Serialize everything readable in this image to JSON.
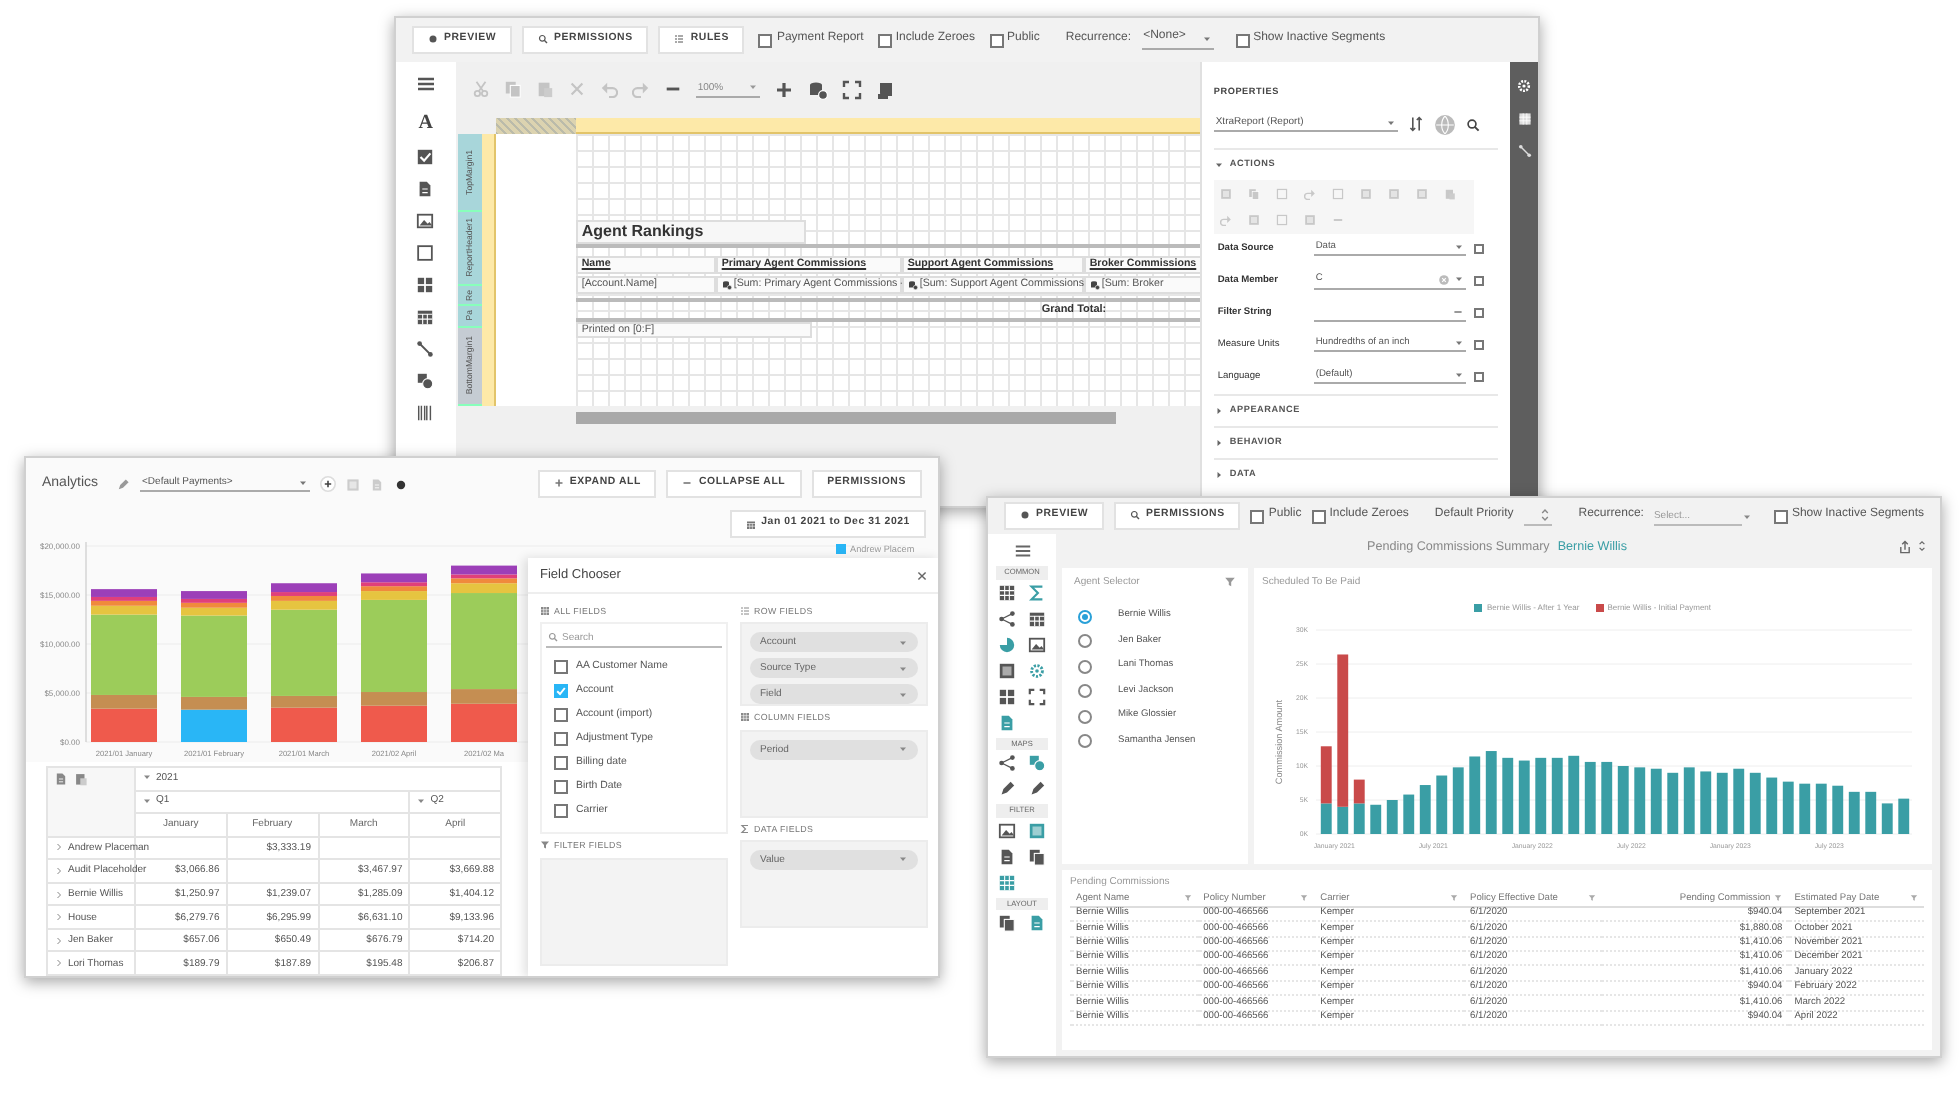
{
  "designer": {
    "buttons": [
      "PREVIEW",
      "PERMISSIONS",
      "RULES"
    ],
    "options": [
      {
        "label": "Payment Report",
        "checked": false
      },
      {
        "label": "Include Zeroes",
        "checked": false
      },
      {
        "label": "Public",
        "checked": false
      }
    ],
    "recurrence": {
      "label": "Recurrence:",
      "value": "<None>"
    },
    "show_inactive": {
      "label": "Show Inactive Segments",
      "checked": false
    },
    "toolbox_letter": "A",
    "zoom": "100%",
    "bands": [
      "TopMargin1",
      "ReportHeader1",
      "Re",
      "Pa",
      "BottomMargin1"
    ],
    "report": {
      "title": "Agent Rankings",
      "columns": [
        "Name",
        "Primary Agent Commissions",
        "Support Agent Commissions",
        "Broker Commissions"
      ],
      "fields": [
        "[Account.Name]",
        "[Sum: Primary Agent Commissions -",
        "[Sum: Support Agent Commissions",
        "[Sum: Broker"
      ],
      "total_label": "Grand Total:",
      "footer": "Printed on [0:F]"
    },
    "properties": {
      "heading": "PROPERTIES",
      "object": "XtraReport (Report)",
      "open_section": "ACTIONS",
      "rows": [
        {
          "label": "Data Source",
          "value": "Data",
          "kind": "select",
          "bold": true,
          "checked": false
        },
        {
          "label": "Data Member",
          "value": "C",
          "kind": "clearable",
          "bold": true,
          "checked": false
        },
        {
          "label": "Filter String",
          "kind": "editor",
          "bold": true,
          "checked": false
        },
        {
          "label": "Measure Units",
          "value": "Hundredths of an inch",
          "kind": "select",
          "bold": false,
          "checked": false
        },
        {
          "label": "Language",
          "value": "(Default)",
          "kind": "select",
          "bold": false,
          "checked": false
        }
      ],
      "sections": [
        "APPEARANCE",
        "BEHAVIOR",
        "DATA"
      ]
    }
  },
  "analytics": {
    "title": "Analytics",
    "layout": "<Default Payments>",
    "buttons": [
      "EXPAND ALL",
      "COLLAPSE ALL",
      "PERMISSIONS"
    ],
    "date_range": "Jan 01 2021 to Dec 31 2021",
    "chart_data": {
      "type": "bar",
      "stacked": true,
      "grid": true,
      "ylim": [
        0,
        20000
      ],
      "categories": [
        "2021/01 January",
        "2021/01 February",
        "2021/01 March",
        "2021/02 April",
        "2021/02 Ma"
      ],
      "yticks": [
        {
          "value": 0,
          "label": "$0.00"
        },
        {
          "value": 5000,
          "label": "$5,000.00"
        },
        {
          "value": 10000,
          "label": "$10,000.00"
        },
        {
          "value": 15000,
          "label": "$15,000.00"
        },
        {
          "value": 20000,
          "label": "$20,000.00"
        }
      ],
      "series": [
        {
          "color": "#ef5a4c",
          "values": [
            3400,
            0,
            3500,
            3700,
            3900
          ]
        },
        {
          "name": "Andrew Placem",
          "color": "#29b6f6",
          "values": [
            0,
            3300,
            0,
            0,
            0
          ]
        },
        {
          "color": "#c58e52",
          "values": [
            1400,
            1300,
            1200,
            1400,
            1500
          ]
        },
        {
          "color": "#9ccc5a",
          "values": [
            8200,
            8300,
            8800,
            9400,
            9800
          ]
        },
        {
          "color": "#e6c440",
          "values": [
            900,
            800,
            900,
            900,
            1000
          ]
        },
        {
          "color": "#f08a3c",
          "values": [
            500,
            500,
            500,
            500,
            500
          ]
        },
        {
          "color": "#e0407a",
          "values": [
            400,
            400,
            400,
            400,
            400
          ]
        },
        {
          "color": "#9c3fb8",
          "values": [
            800,
            800,
            900,
            900,
            900
          ]
        }
      ]
    },
    "pivot": {
      "year": "2021",
      "quarters": [
        {
          "label": "Q1",
          "months": [
            "January",
            "February",
            "March"
          ]
        },
        {
          "label": "Q2",
          "months": [
            "April"
          ]
        }
      ],
      "rows": [
        {
          "name": "Andrew Placeman",
          "cells": [
            {
              "kind": "empty"
            },
            {
              "kind": "amount",
              "value": "$3,333.19"
            },
            {
              "kind": "empty"
            },
            {
              "kind": "empty"
            }
          ]
        },
        {
          "name": "Audit Placeholder",
          "cells": [
            {
              "kind": "amount",
              "value": "$3,066.86"
            },
            {
              "kind": "empty"
            },
            {
              "kind": "amount",
              "value": "$3,467.97"
            },
            {
              "kind": "amount",
              "value": "$3,669.88"
            }
          ]
        },
        {
          "name": "Bernie Willis",
          "cells": [
            {
              "kind": "amount",
              "value": "$1,250.97"
            },
            {
              "kind": "amount",
              "value": "$1,239.07"
            },
            {
              "kind": "amount",
              "value": "$1,285.09"
            },
            {
              "kind": "amount",
              "value": "$1,404.12"
            }
          ]
        },
        {
          "name": "House",
          "cells": [
            {
              "kind": "amount",
              "value": "$6,279.76"
            },
            {
              "kind": "amount",
              "value": "$6,295.99"
            },
            {
              "kind": "amount",
              "value": "$6,631.10"
            },
            {
              "kind": "amount",
              "value": "$9,133.96"
            }
          ]
        },
        {
          "name": "Jen Baker",
          "cells": [
            {
              "kind": "amount",
              "value": "$657.06"
            },
            {
              "kind": "amount",
              "value": "$650.49"
            },
            {
              "kind": "amount",
              "value": "$676.79"
            },
            {
              "kind": "amount",
              "value": "$714.20"
            }
          ]
        },
        {
          "name": "Lori Thomas",
          "cells": [
            {
              "kind": "amount",
              "value": "$189.79"
            },
            {
              "kind": "amount",
              "value": "$187.89"
            },
            {
              "kind": "amount",
              "value": "$195.48"
            },
            {
              "kind": "amount",
              "value": "$206.87"
            }
          ]
        }
      ]
    },
    "field_chooser": {
      "title": "Field Chooser",
      "all_fields": {
        "label": "ALL FIELDS",
        "placeholder": "Search",
        "items": [
          {
            "label": "AA Customer Name",
            "checked": false
          },
          {
            "label": "Account",
            "checked": true
          },
          {
            "label": "Account (import)",
            "checked": false
          },
          {
            "label": "Adjustment Type",
            "checked": false
          },
          {
            "label": "Billing date",
            "checked": false
          },
          {
            "label": "Birth Date",
            "checked": false
          },
          {
            "label": "Carrier",
            "checked": false
          }
        ]
      },
      "row_fields": {
        "label": "ROW FIELDS",
        "items": [
          "Account",
          "Source Type",
          "Field"
        ]
      },
      "column_fields": {
        "label": "COLUMN FIELDS",
        "items": [
          "Period"
        ]
      },
      "filter_fields": {
        "label": "FILTER FIELDS"
      },
      "data_fields": {
        "label": "DATA FIELDS",
        "items": [
          "Value"
        ]
      }
    }
  },
  "pending": {
    "buttons": [
      "PREVIEW",
      "PERMISSIONS"
    ],
    "options": [
      {
        "label": "Public",
        "checked": false
      },
      {
        "label": "Include Zeroes",
        "checked": false
      }
    ],
    "priority_label": "Default Priority",
    "recurrence": {
      "label": "Recurrence:",
      "placeholder": "Select..."
    },
    "show_inactive": {
      "label": "Show Inactive Segments",
      "checked": false
    },
    "title": "Pending Commissions Summary",
    "agent": "Bernie Willis",
    "toolbox_sections": [
      "COMMON",
      "MAPS",
      "FILTER",
      "LAYOUT"
    ],
    "agent_selector": {
      "title": "Agent Selector",
      "agents": [
        {
          "name": "Bernie Willis",
          "selected": true
        },
        {
          "name": "Jen Baker",
          "selected": false
        },
        {
          "name": "Lani Thomas",
          "selected": false
        },
        {
          "name": "Levi Jackson",
          "selected": false
        },
        {
          "name": "Mike Glossier",
          "selected": false
        },
        {
          "name": "Samantha Jensen",
          "selected": false
        }
      ]
    },
    "chart": {
      "title": "Scheduled To Be Paid",
      "chart_data": {
        "type": "bar",
        "stacked": true,
        "grid": true,
        "ylim": [
          0,
          30000
        ],
        "ylabel": "Commission Amount",
        "categories": [
          "January 2021",
          null,
          null,
          null,
          null,
          null,
          "July 2021",
          null,
          null,
          null,
          null,
          null,
          "January 2022",
          null,
          null,
          null,
          null,
          null,
          "July 2022",
          null,
          null,
          null,
          null,
          null,
          "January 2023",
          null,
          null,
          null,
          null,
          null,
          "July 2023",
          null,
          null,
          null,
          null,
          null
        ],
        "yticks": [
          {
            "value": 0,
            "label": "0K"
          },
          {
            "value": 5000,
            "label": "5K"
          },
          {
            "value": 10000,
            "label": "10K"
          },
          {
            "value": 15000,
            "label": "15K"
          },
          {
            "value": 20000,
            "label": "20K"
          },
          {
            "value": 25000,
            "label": "25K"
          },
          {
            "value": 30000,
            "label": "30K"
          }
        ],
        "series": [
          {
            "name": "Bernie Willis - After 1 Year",
            "color": "#3a9ea5",
            "values": [
              4500,
              4000,
              4500,
              4300,
              5000,
              5800,
              7200,
              8600,
              9800,
              11400,
              12200,
              11200,
              10800,
              11200,
              11200,
              11500,
              10600,
              10600,
              10000,
              9800,
              9600,
              9000,
              9800,
              9200,
              9000,
              9600,
              9000,
              8300,
              7700,
              7400,
              7400,
              7100,
              6200,
              6200,
              4500,
              5200
            ]
          },
          {
            "name": "Bernie Willis - Initial Payment",
            "color": "#c94a4a",
            "values": [
              8400,
              22400,
              3500,
              0,
              0,
              0,
              0,
              0,
              0,
              0,
              0,
              0,
              0,
              0,
              0,
              0,
              0,
              0,
              0,
              0,
              0,
              0,
              0,
              0,
              0,
              0,
              0,
              0,
              0,
              0,
              0,
              0,
              0,
              0,
              0,
              0
            ]
          }
        ]
      }
    },
    "table": {
      "title": "Pending Commissions",
      "columns": [
        "Agent Name",
        "Policy Number",
        "Carrier",
        "Policy Effective Date",
        "Pending Commission",
        "Estimated Pay Date"
      ],
      "rows": [
        [
          "Bernie Willis",
          "000-00-466566",
          "Kemper",
          "6/1/2020",
          "$940.04",
          "September 2021"
        ],
        [
          "Bernie Willis",
          "000-00-466566",
          "Kemper",
          "6/1/2020",
          "$1,880.08",
          "October 2021"
        ],
        [
          "Bernie Willis",
          "000-00-466566",
          "Kemper",
          "6/1/2020",
          "$1,410.06",
          "November 2021"
        ],
        [
          "Bernie Willis",
          "000-00-466566",
          "Kemper",
          "6/1/2020",
          "$1,410.06",
          "December 2021"
        ],
        [
          "Bernie Willis",
          "000-00-466566",
          "Kemper",
          "6/1/2020",
          "$1,410.06",
          "January 2022"
        ],
        [
          "Bernie Willis",
          "000-00-466566",
          "Kemper",
          "6/1/2020",
          "$940.04",
          "February 2022"
        ],
        [
          "Bernie Willis",
          "000-00-466566",
          "Kemper",
          "6/1/2020",
          "$1,410.06",
          "March 2022"
        ],
        [
          "Bernie Willis",
          "000-00-466566",
          "Kemper",
          "6/1/2020",
          "$940.04",
          "April 2022"
        ]
      ]
    }
  }
}
